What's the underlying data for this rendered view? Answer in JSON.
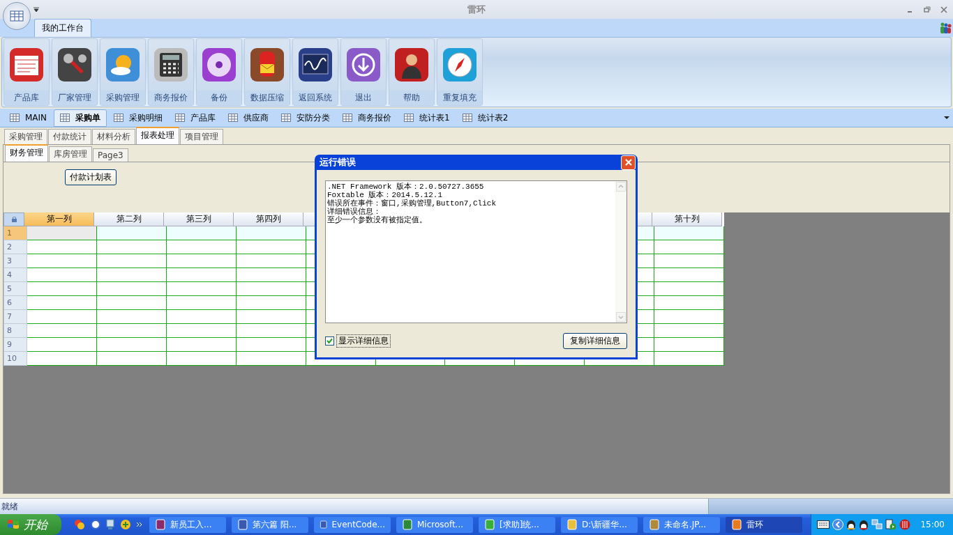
{
  "window": {
    "title": "雷环"
  },
  "ribbon": {
    "tab": {
      "label": "我的工作台",
      "selected": true
    },
    "buttons": [
      "产品库",
      "厂家管理",
      "采购管理",
      "商务报价",
      "备份",
      "数据压缩",
      "返回系统",
      "退出",
      "帮助",
      "重复填充"
    ]
  },
  "doc_tabs": [
    {
      "label": "MAIN",
      "selected": false
    },
    {
      "label": "采购单",
      "selected": true
    },
    {
      "label": "采购明细",
      "selected": false
    },
    {
      "label": "产品库",
      "selected": false
    },
    {
      "label": "供应商",
      "selected": false
    },
    {
      "label": "安防分类",
      "selected": false
    },
    {
      "label": "商务报价",
      "selected": false
    },
    {
      "label": "统计表1",
      "selected": false
    },
    {
      "label": "统计表2",
      "selected": false
    }
  ],
  "sub_tabs": [
    {
      "label": "采购管理",
      "selected": false
    },
    {
      "label": "付款统计",
      "selected": false
    },
    {
      "label": "材料分析",
      "selected": false
    },
    {
      "label": "报表处理",
      "selected": true
    },
    {
      "label": "项目管理",
      "selected": false
    }
  ],
  "inner_tabs": [
    {
      "label": "财务管理",
      "selected": true
    },
    {
      "label": "库房管理",
      "selected": false
    },
    {
      "label": "Page3",
      "selected": false
    }
  ],
  "plan_button": "付款计划表",
  "grid": {
    "columns": [
      {
        "label": "第一列",
        "selected": true
      },
      {
        "label": "第二列",
        "selected": false
      },
      {
        "label": "第三列",
        "selected": false
      },
      {
        "label": "第四列",
        "selected": false
      },
      {
        "label": "第十列",
        "selected": false
      }
    ],
    "rows": [
      {
        "label": "1",
        "selected": true
      },
      {
        "label": "2",
        "selected": false
      },
      {
        "label": "3",
        "selected": false
      },
      {
        "label": "4",
        "selected": false
      },
      {
        "label": "5",
        "selected": false
      },
      {
        "label": "6",
        "selected": false
      },
      {
        "label": "7",
        "selected": false
      },
      {
        "label": "8",
        "selected": false
      },
      {
        "label": "9",
        "selected": false
      },
      {
        "label": "10",
        "selected": false
      }
    ]
  },
  "dialog": {
    "title": "运行错误",
    "lines": [
      ".NET Framework 版本：2.0.50727.3655",
      "Foxtable 版本：2014.5.12.1",
      "错误所在事件：窗口,采购管理,Button7,Click",
      "详细错误信息：",
      "至少一个参数没有被指定值。"
    ],
    "checkbox": {
      "label": "显示详细信息",
      "checked": true
    },
    "copy_button": "复制详细信息"
  },
  "status_bar": {
    "text": "就绪"
  },
  "taskbar": {
    "start": "开始",
    "windows": [
      {
        "label": "新员工入...",
        "selected": false
      },
      {
        "label": "第六篇 阳...",
        "selected": false
      },
      {
        "label": "EventCode...",
        "selected": false
      },
      {
        "label": "Microsoft...",
        "selected": false
      },
      {
        "label": "[求助]统...",
        "selected": false
      },
      {
        "label": "D:\\新疆华...",
        "selected": false
      },
      {
        "label": "未命名.JP...",
        "selected": false
      },
      {
        "label": "雷环",
        "selected": true
      }
    ],
    "clock": "15:00"
  }
}
